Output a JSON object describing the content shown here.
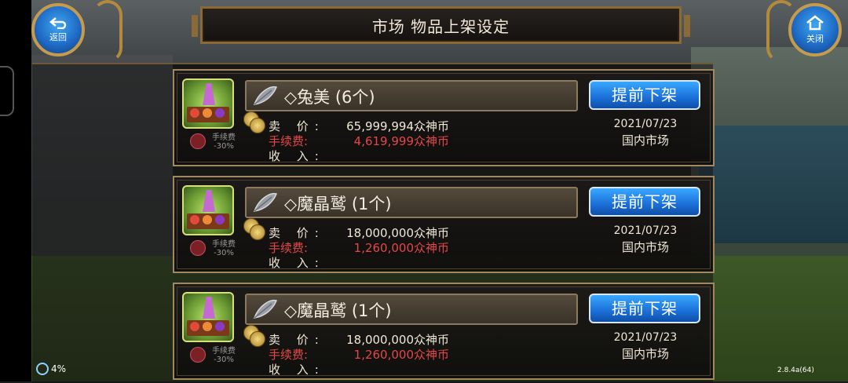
{
  "header": {
    "title": "市场 物品上架设定",
    "back_label": "返回",
    "close_label": "关闭"
  },
  "labels": {
    "sell": "卖 价:",
    "fee": "手续费:",
    "income": "收 入:",
    "fee_discount_title": "手续费",
    "fee_discount_value": "-30%"
  },
  "items": [
    {
      "name": "◇兔美 (6个)",
      "sell_price": "65,999,994众神币",
      "fee": "4,619,999众神币",
      "income": "",
      "button": "提前下架",
      "date": "2021/07/23",
      "market": "国内市场"
    },
    {
      "name": "◇魔晶鹫 (1个)",
      "sell_price": "18,000,000众神币",
      "fee": "1,260,000众神币",
      "income": "",
      "button": "提前下架",
      "date": "2021/07/23",
      "market": "国内市场"
    },
    {
      "name": "◇魔晶鹫 (1个)",
      "sell_price": "18,000,000众神币",
      "fee": "1,260,000众神币",
      "income": "",
      "button": "提前下架",
      "date": "2021/07/23",
      "market": "国内市场"
    }
  ],
  "status": {
    "percent": "4%",
    "version": "2.8.4a(64)"
  },
  "colors": {
    "accent_blue": "#1f6bc6",
    "fee_red": "#e34747",
    "frame_gold": "#a08860"
  }
}
